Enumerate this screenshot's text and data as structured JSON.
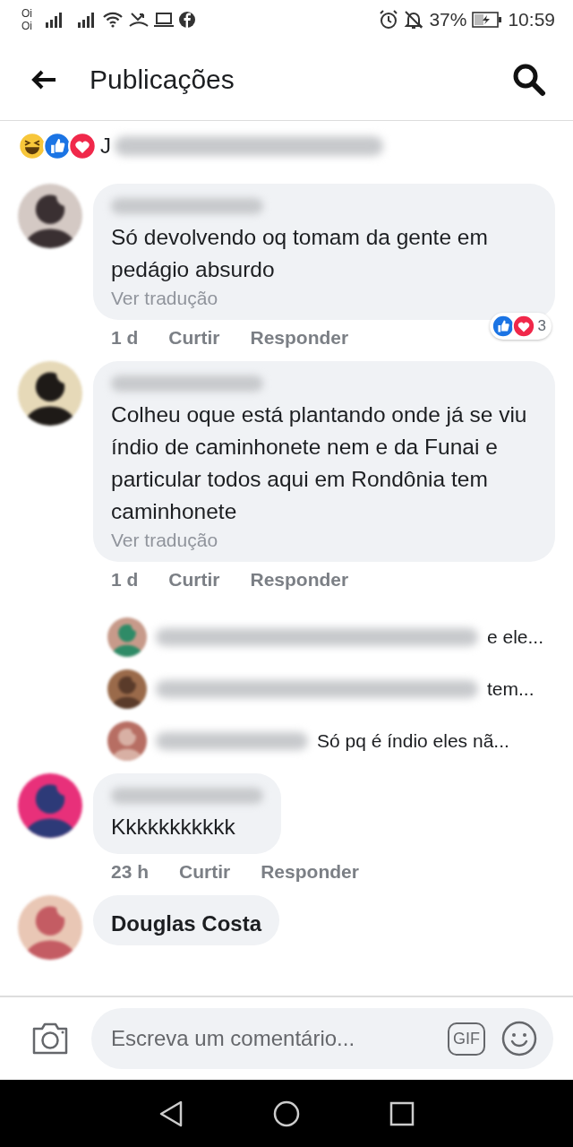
{
  "status_bar": {
    "carriers": [
      "Oi",
      "Oi"
    ],
    "battery_percent": "37%",
    "time": "10:59"
  },
  "header": {
    "title": "Publicações"
  },
  "reactions_summary": {
    "visible_text": "J"
  },
  "comments": [
    {
      "text": "Só devolvendo oq tomam da gente em pedágio absurdo",
      "translate": "Ver tradução",
      "time": "1 d",
      "like": "Curtir",
      "reply": "Responder",
      "reaction_count": "3"
    },
    {
      "text": "Colheu oque está plantando onde já se viu índio de caminhonete nem e da Funai e particular todos aqui em Rondônia tem caminhonete",
      "translate": "Ver tradução",
      "time": "1 d",
      "like": "Curtir",
      "reply": "Responder",
      "replies": [
        {
          "snippet": "e ele..."
        },
        {
          "snippet": "tem..."
        },
        {
          "snippet": "Só  pq é  índio eles nã..."
        }
      ]
    },
    {
      "text": "Kkkkkkkkkkk",
      "time": "23 h",
      "like": "Curtir",
      "reply": "Responder"
    },
    {
      "author": "Douglas Costa"
    }
  ],
  "composer": {
    "placeholder": "Escreva um comentário...",
    "gif_label": "GIF"
  }
}
